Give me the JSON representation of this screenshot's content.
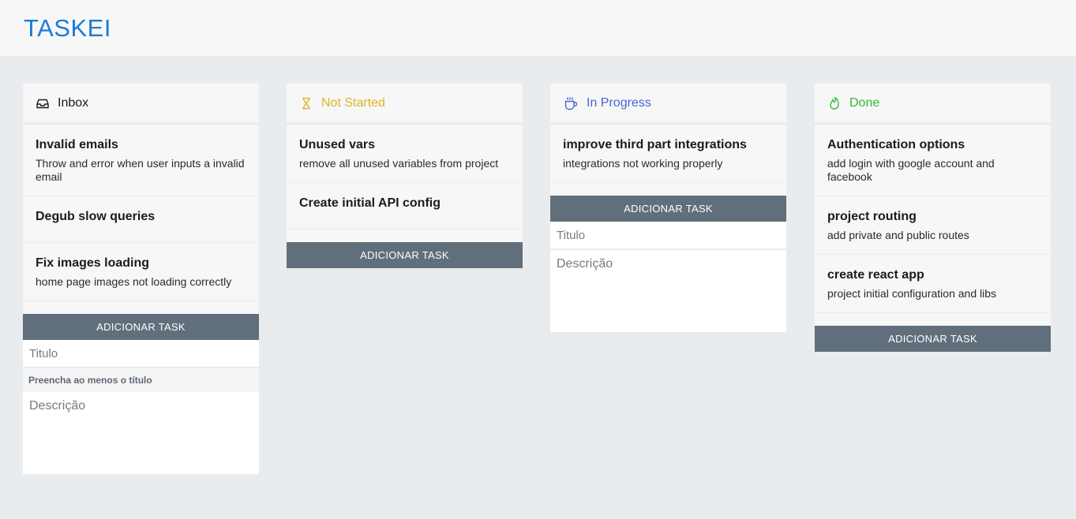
{
  "app": {
    "title": "TASKEI"
  },
  "columns": [
    {
      "name": "Inbox",
      "color": "#1b1b1b",
      "icon": "inbox-icon",
      "cards": [
        {
          "title": "Invalid emails",
          "description": "Throw and error when user inputs a invalid email"
        },
        {
          "title": "Degub slow queries",
          "description": ""
        },
        {
          "title": "Fix images loading",
          "description": "home page images not loading correctly"
        }
      ],
      "add_label": "ADICIONAR TASK",
      "form": {
        "title_placeholder": "Titulo",
        "warning": "Preencha ao menos o título",
        "description_placeholder": "Descrição"
      }
    },
    {
      "name": "Not Started",
      "color": "#e0b42a",
      "icon": "hourglass-icon",
      "cards": [
        {
          "title": "Unused vars",
          "description": "remove all unused variables from project"
        },
        {
          "title": "Create initial API config",
          "description": ""
        }
      ],
      "add_label": "ADICIONAR TASK"
    },
    {
      "name": "In Progress",
      "color": "#4a63d6",
      "icon": "coffee-cup-icon",
      "cards": [
        {
          "title": "improve third part integrations",
          "description": "integrations not working properly"
        }
      ],
      "add_label": "ADICIONAR TASK",
      "form": {
        "title_placeholder": "Titulo",
        "description_placeholder": "Descrição"
      }
    },
    {
      "name": "Done",
      "color": "#2ec02e",
      "icon": "flame-icon",
      "cards": [
        {
          "title": "Authentication options",
          "description": "add login with google account and facebook"
        },
        {
          "title": "project routing",
          "description": "add private and public routes"
        },
        {
          "title": "create react app",
          "description": "project initial configuration and libs"
        }
      ],
      "add_label": "ADICIONAR TASK"
    }
  ]
}
